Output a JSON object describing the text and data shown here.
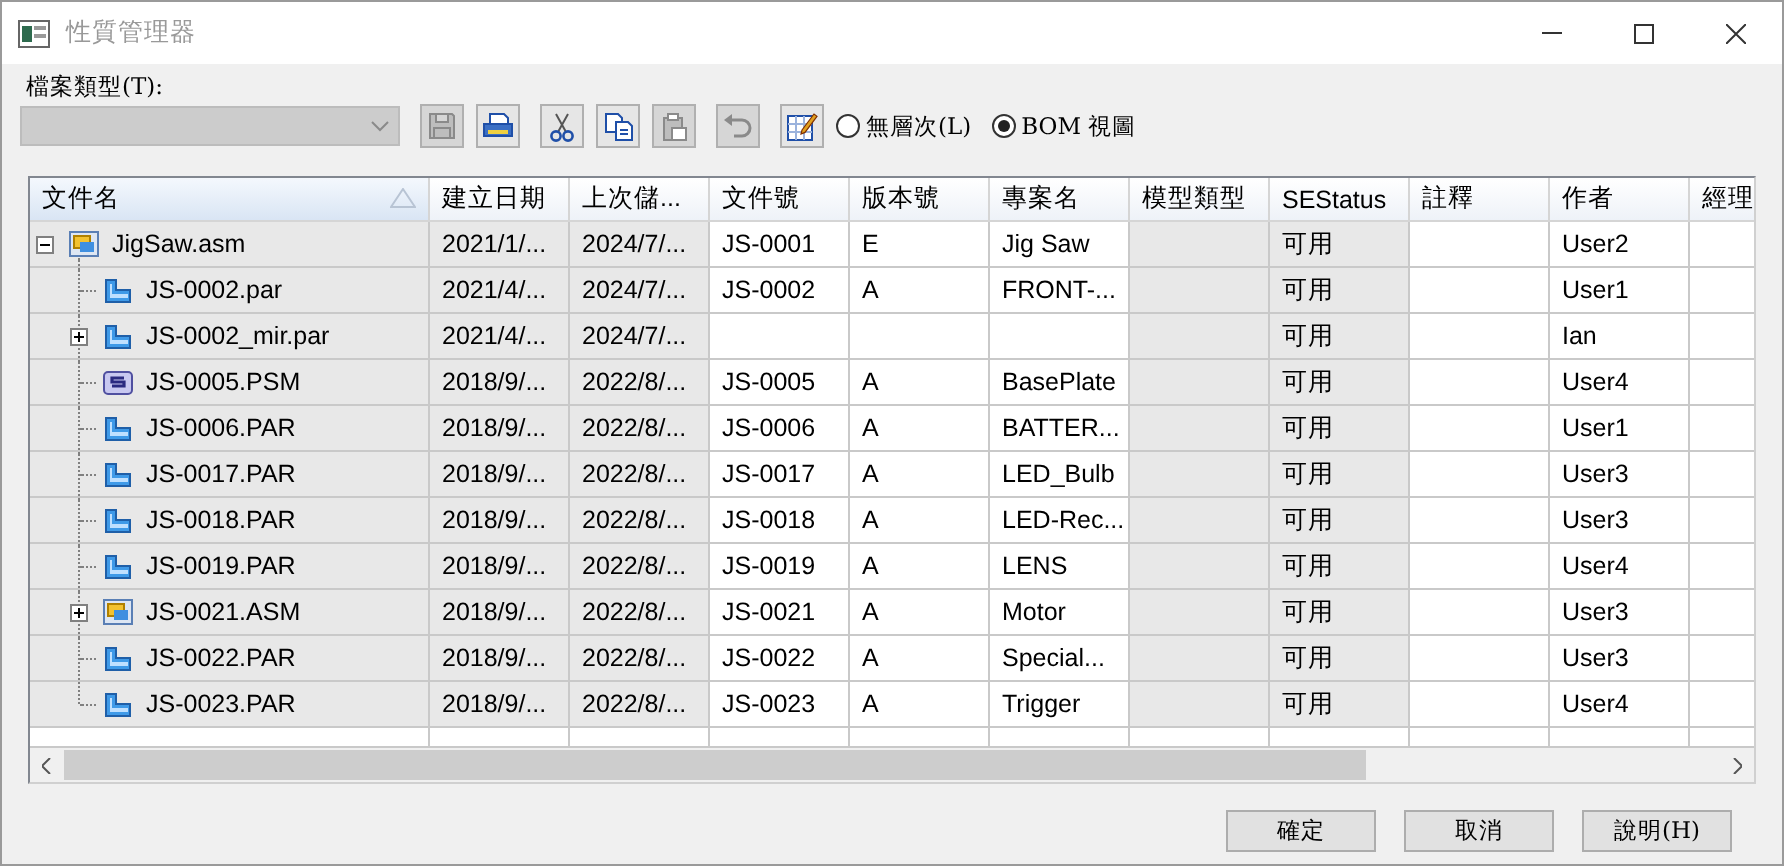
{
  "window": {
    "title": "性質管理器"
  },
  "file_type": {
    "label": "檔案類型(T):",
    "disabled": true
  },
  "toolbar": [
    {
      "kind": "save",
      "disabled": true
    },
    {
      "kind": "print",
      "disabled": false
    },
    {
      "kind": "cut",
      "disabled": false
    },
    {
      "kind": "copy",
      "disabled": false
    },
    {
      "kind": "paste",
      "disabled": true
    },
    {
      "kind": "undo",
      "disabled": true
    },
    {
      "kind": "edit",
      "disabled": false
    }
  ],
  "view_options": [
    {
      "label": "無層次(L)",
      "selected": false
    },
    {
      "label": "BOM 視圖",
      "selected": true
    }
  ],
  "table": {
    "columns": [
      {
        "label": "文件名",
        "sorted": true,
        "readonly": true
      },
      {
        "label": "建立日期",
        "sorted": false,
        "readonly": true
      },
      {
        "label": "上次儲...",
        "sorted": false,
        "readonly": true
      },
      {
        "label": "文件號",
        "sorted": false,
        "readonly": false
      },
      {
        "label": "版本號",
        "sorted": false,
        "readonly": false
      },
      {
        "label": "專案名",
        "sorted": false,
        "readonly": false
      },
      {
        "label": "模型類型",
        "sorted": false,
        "readonly": true
      },
      {
        "label": "SEStatus",
        "sorted": false,
        "readonly": true
      },
      {
        "label": "註釋",
        "sorted": false,
        "readonly": false
      },
      {
        "label": "作者",
        "sorted": false,
        "readonly": false
      },
      {
        "label": "經理",
        "sorted": false,
        "readonly": false
      }
    ],
    "rows": [
      {
        "kind": "asm",
        "expanded": true,
        "cells": [
          "JigSaw.asm",
          "2021/1/...",
          "2024/7/...",
          "JS-0001",
          "E",
          "Jig Saw",
          "",
          "可用",
          "",
          "User2",
          ""
        ],
        "children": [
          {
            "kind": "par",
            "cells": [
              "JS-0002.par",
              "2021/4/...",
              "2024/7/...",
              "JS-0002",
              "A",
              "FRONT-...",
              "",
              "可用",
              "",
              "User1",
              ""
            ]
          },
          {
            "kind": "par",
            "expanded": false,
            "cells": [
              "JS-0002_mir.par",
              "2021/4/...",
              "2024/7/...",
              "",
              "",
              "",
              "",
              "可用",
              "",
              "Ian",
              ""
            ]
          },
          {
            "kind": "psm",
            "cells": [
              "JS-0005.PSM",
              "2018/9/...",
              "2022/8/...",
              "JS-0005",
              "A",
              "BasePlate",
              "",
              "可用",
              "",
              "User4",
              ""
            ]
          },
          {
            "kind": "par",
            "cells": [
              "JS-0006.PAR",
              "2018/9/...",
              "2022/8/...",
              "JS-0006",
              "A",
              "BATTER...",
              "",
              "可用",
              "",
              "User1",
              ""
            ]
          },
          {
            "kind": "par",
            "cells": [
              "JS-0017.PAR",
              "2018/9/...",
              "2022/8/...",
              "JS-0017",
              "A",
              "LED_Bulb",
              "",
              "可用",
              "",
              "User3",
              ""
            ]
          },
          {
            "kind": "par",
            "cells": [
              "JS-0018.PAR",
              "2018/9/...",
              "2022/8/...",
              "JS-0018",
              "A",
              "LED-Rec...",
              "",
              "可用",
              "",
              "User3",
              ""
            ]
          },
          {
            "kind": "par",
            "cells": [
              "JS-0019.PAR",
              "2018/9/...",
              "2022/8/...",
              "JS-0019",
              "A",
              "LENS",
              "",
              "可用",
              "",
              "User4",
              ""
            ]
          },
          {
            "kind": "asm",
            "expanded": false,
            "cells": [
              "JS-0021.ASM",
              "2018/9/...",
              "2022/8/...",
              "JS-0021",
              "A",
              "Motor",
              "",
              "可用",
              "",
              "User3",
              ""
            ]
          },
          {
            "kind": "par",
            "cells": [
              "JS-0022.PAR",
              "2018/9/...",
              "2022/8/...",
              "JS-0022",
              "A",
              "Special...",
              "",
              "可用",
              "",
              "User3",
              ""
            ]
          },
          {
            "kind": "par",
            "cells": [
              "JS-0023.PAR",
              "2018/9/...",
              "2022/8/...",
              "JS-0023",
              "A",
              "Trigger",
              "",
              "可用",
              "",
              "User4",
              ""
            ]
          }
        ]
      }
    ]
  },
  "buttons": [
    "確定",
    "取消",
    "說明(H)"
  ]
}
